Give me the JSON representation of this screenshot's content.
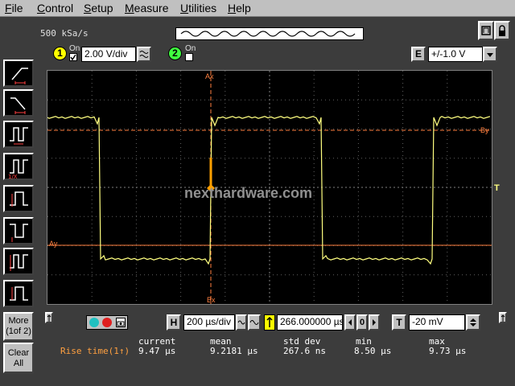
{
  "menu": {
    "items": [
      {
        "label": "File",
        "ul": "F",
        "rest": "ile"
      },
      {
        "label": "Control",
        "ul": "C",
        "rest": "ontrol"
      },
      {
        "label": "Setup",
        "ul": "S",
        "rest": "etup"
      },
      {
        "label": "Measure",
        "ul": "M",
        "rest": "easure"
      },
      {
        "label": "Utilities",
        "ul": "U",
        "rest": "tilities"
      },
      {
        "label": "Help",
        "ul": "H",
        "rest": "elp"
      }
    ]
  },
  "acquisition": {
    "sample_rate": "500 kSa/s"
  },
  "channel1": {
    "number": "1",
    "on_label": "On",
    "on_checked": true,
    "scale": "2.00 V/div"
  },
  "channel2": {
    "number": "2",
    "on_label": "On",
    "on_checked": false
  },
  "e_control": {
    "label": "E",
    "value": "+/-1.0 V"
  },
  "sidebar": {
    "more_label": "More",
    "more_sub": "(1of 2)",
    "clear_label": "Clear",
    "clear_sub": "All"
  },
  "scope": {
    "watermark": "nexthardware.com",
    "marker_ax": "Ax",
    "marker_bx": "Bx",
    "marker_ay": "Ay",
    "marker_by": "By",
    "trigger_marker": "T"
  },
  "timebase": {
    "h_label": "H",
    "scale": "200 µs/div",
    "delay": "266.000000 µs",
    "position_value": "0",
    "t_label": "T",
    "trigger_level": "-20 mV"
  },
  "measurements": {
    "headers": [
      "current",
      "mean",
      "std dev",
      "min",
      "max"
    ],
    "rows": [
      {
        "name": "Rise time(1↑)",
        "values": [
          "9.47 µs",
          "9.2181 µs",
          "267.6 ns",
          "8.50 µs",
          "9.73 µs"
        ]
      }
    ]
  },
  "colors": {
    "trace": "#ffff80",
    "marker": "#ff8040",
    "grid": "#606060",
    "meas_label": "#ffa040",
    "meas_value": "#ffffff"
  }
}
